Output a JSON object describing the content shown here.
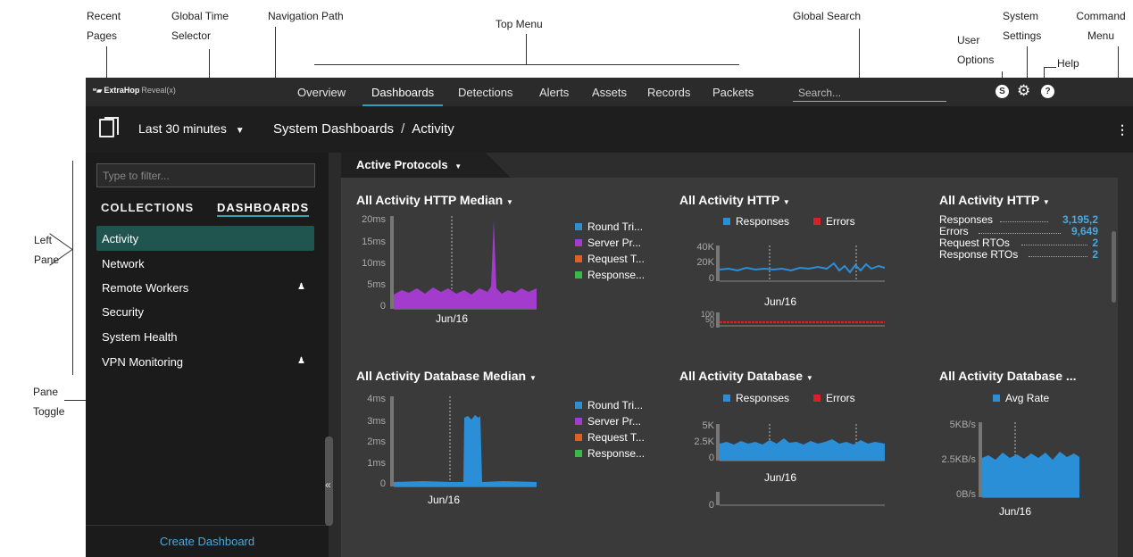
{
  "annotations": {
    "recent_pages": "Recent\nPages",
    "global_time_selector": "Global Time\nSelector",
    "navigation_path": "Navigation Path",
    "top_menu": "Top Menu",
    "global_search": "Global Search",
    "user_options": "User\nOptions",
    "system_settings": "System\nSettings",
    "help": "Help",
    "command_menu": "Command\nMenu",
    "left_pane": "Left\nPane",
    "pane_toggle": "Pane\nToggle"
  },
  "brand": {
    "name": "ExtraHop",
    "product": "Reveal(x)"
  },
  "top_menu": {
    "items": [
      {
        "label": "Overview"
      },
      {
        "label": "Dashboards"
      },
      {
        "label": "Detections"
      },
      {
        "label": "Alerts"
      },
      {
        "label": "Assets"
      },
      {
        "label": "Records"
      },
      {
        "label": "Packets"
      }
    ],
    "active": "Dashboards",
    "search_placeholder": "Search..."
  },
  "user_icon_text": "S",
  "help_icon_text": "?",
  "time_selector": {
    "label": "Last 30 minutes"
  },
  "breadcrumb": {
    "parent": "System Dashboards",
    "separator": "/",
    "current": "Activity"
  },
  "left_pane": {
    "filter_placeholder": "Type to filter...",
    "tabs": [
      {
        "label": "COLLECTIONS"
      },
      {
        "label": "DASHBOARDS"
      }
    ],
    "items": [
      {
        "label": "Activity",
        "active": true,
        "shared": false
      },
      {
        "label": "Network",
        "active": false,
        "shared": false
      },
      {
        "label": "Remote Workers",
        "active": false,
        "shared": true
      },
      {
        "label": "Security",
        "active": false,
        "shared": false
      },
      {
        "label": "System Health",
        "active": false,
        "shared": false
      },
      {
        "label": "VPN Monitoring",
        "active": false,
        "shared": true
      }
    ],
    "create_label": "Create Dashboard",
    "toggle_glyph": "«"
  },
  "region": {
    "title": "Active Protocols"
  },
  "widgets": {
    "http_median": {
      "title": "All Activity HTTP Median",
      "yticks": [
        "20ms",
        "15ms",
        "10ms",
        "5ms",
        "0"
      ],
      "xtick": "Jun/16",
      "legend": [
        "Round Tri...",
        "Server Pr...",
        "Request T...",
        "Response..."
      ]
    },
    "http": {
      "title": "All Activity HTTP",
      "legend": [
        "Responses",
        "Errors"
      ],
      "yticks": [
        "40K",
        "20K",
        "0"
      ],
      "xtick": "Jun/16",
      "yticks_small": [
        "100",
        "50",
        "0"
      ]
    },
    "http_stats": {
      "title": "All Activity HTTP",
      "rows": [
        {
          "label": "Responses",
          "value": "3,195,2"
        },
        {
          "label": "Errors",
          "value": "9,649"
        },
        {
          "label": "Request RTOs",
          "value": "2"
        },
        {
          "label": "Response RTOs",
          "value": "2"
        }
      ]
    },
    "db_median": {
      "title": "All Activity Database Median",
      "yticks": [
        "4ms",
        "3ms",
        "2ms",
        "1ms",
        "0"
      ],
      "xtick": "Jun/16",
      "legend": [
        "Round Tri...",
        "Server Pr...",
        "Request T...",
        "Response..."
      ]
    },
    "db": {
      "title": "All Activity Database",
      "legend": [
        "Responses",
        "Errors"
      ],
      "yticks": [
        "5K",
        "2.5K",
        "0"
      ],
      "xtick": "Jun/16",
      "ytick_small": "0"
    },
    "db_rate": {
      "title": "All Activity Database ...",
      "legend": "Avg Rate",
      "yticks": [
        "5KB/s",
        "2.5KB/s",
        "0B/s"
      ],
      "xtick": "Jun/16"
    }
  },
  "colors": {
    "accent": "#2fa3b5",
    "link": "#4aa8e0",
    "round_trip": "#2b8fd8",
    "server_processing": "#a33ccc",
    "request_transfer": "#d9622b",
    "response_transfer": "#3cb84b",
    "responses": "#2b8fd8",
    "errors": "#d6202a"
  }
}
